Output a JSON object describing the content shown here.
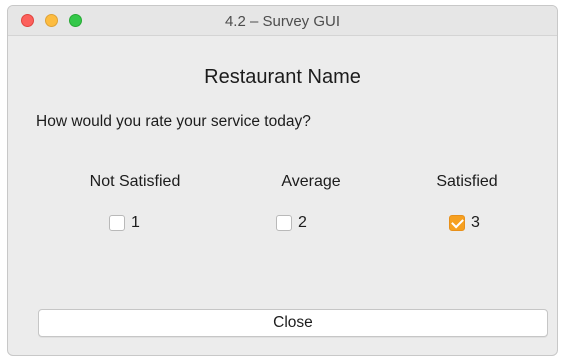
{
  "window": {
    "title": "4.2 – Survey GUI"
  },
  "heading": "Restaurant Name",
  "question": "How would you rate your service today?",
  "ratings": [
    {
      "label": "Not Satisfied",
      "value": "1",
      "checked": false
    },
    {
      "label": "Average",
      "value": "2",
      "checked": false
    },
    {
      "label": "Satisfied",
      "value": "3",
      "checked": true
    }
  ],
  "buttons": {
    "close_label": "Close"
  },
  "colors": {
    "accent": "#f6a020",
    "window_bg": "#ececec",
    "traffic_close": "#fc605c",
    "traffic_min": "#fdbc40",
    "traffic_max": "#34c84a"
  }
}
